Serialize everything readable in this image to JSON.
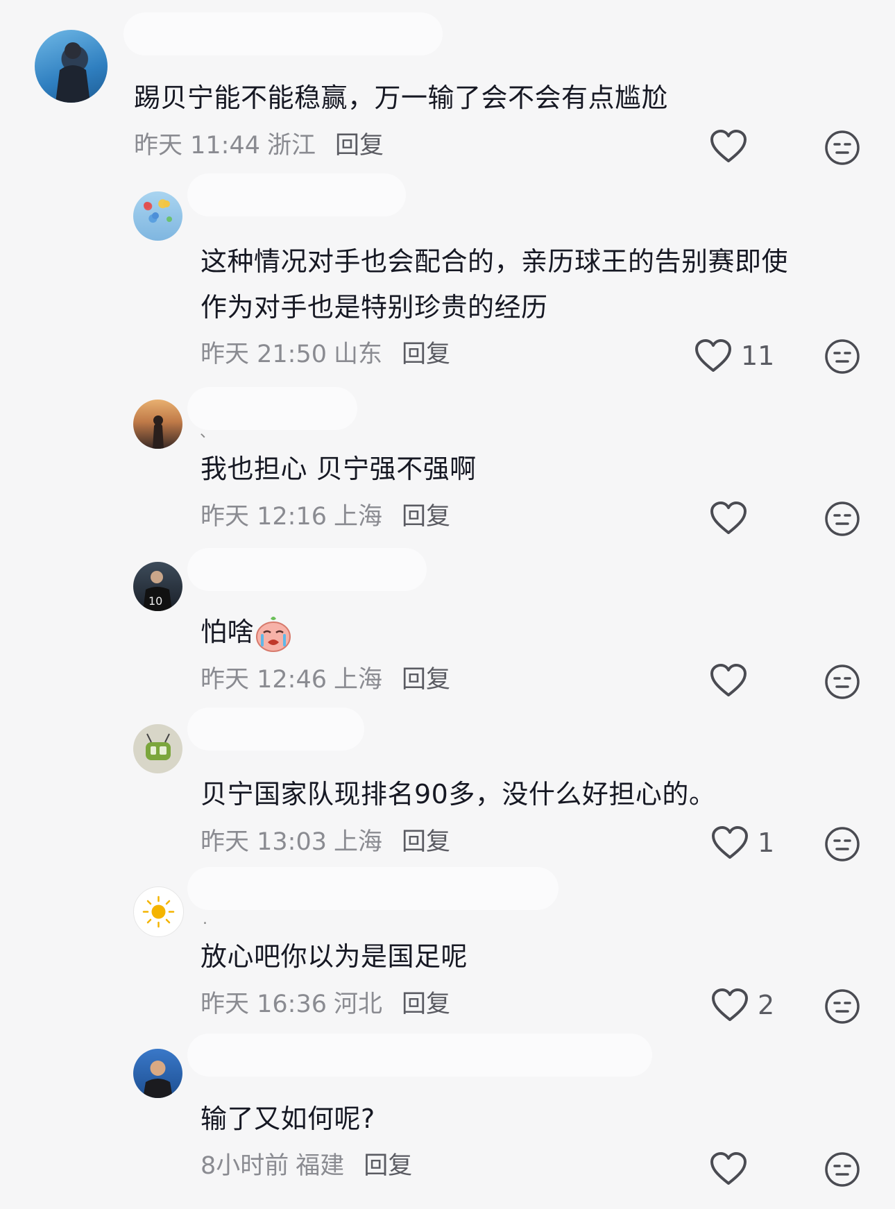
{
  "comments": [
    {
      "text": [
        "踢贝宁能不能稳赢，万一输了会不会有点尴尬"
      ],
      "time": "昨天 11:44",
      "location": "浙江",
      "reply_label": "回复",
      "likes": ""
    },
    {
      "text": [
        "这种情况对手也会配合的，亲历球王的告别赛即使",
        "作为对手也是特别珍贵的经历"
      ],
      "time": "昨天 21:50",
      "location": "山东",
      "reply_label": "回复",
      "likes": "11"
    },
    {
      "text": [
        "我也担心 贝宁强不强啊"
      ],
      "time": "昨天 12:16",
      "location": "上海",
      "reply_label": "回复",
      "likes": ""
    },
    {
      "text": [
        "怕啥"
      ],
      "time": "昨天 12:46",
      "location": "上海",
      "reply_label": "回复",
      "likes": ""
    },
    {
      "text": [
        "贝宁国家队现排名90多，没什么好担心的。"
      ],
      "time": "昨天 13:03",
      "location": "上海",
      "reply_label": "回复",
      "likes": "1"
    },
    {
      "text": [
        "放心吧你以为是国足呢"
      ],
      "time": "昨天 16:36",
      "location": "河北",
      "reply_label": "回复",
      "likes": "2"
    },
    {
      "text": [
        "输了又如何呢?"
      ],
      "time": "8小时前",
      "location": "福建",
      "reply_label": "回复",
      "likes": ""
    }
  ],
  "icons": {
    "like": "heart-outline-icon",
    "dislike": "neutral-face-icon",
    "emoji": "crying-face-emoji"
  },
  "colors": {
    "background": "#f6f6f7",
    "text": "#161823",
    "meta": "#8a8b91",
    "icon": "#4a4b52"
  }
}
